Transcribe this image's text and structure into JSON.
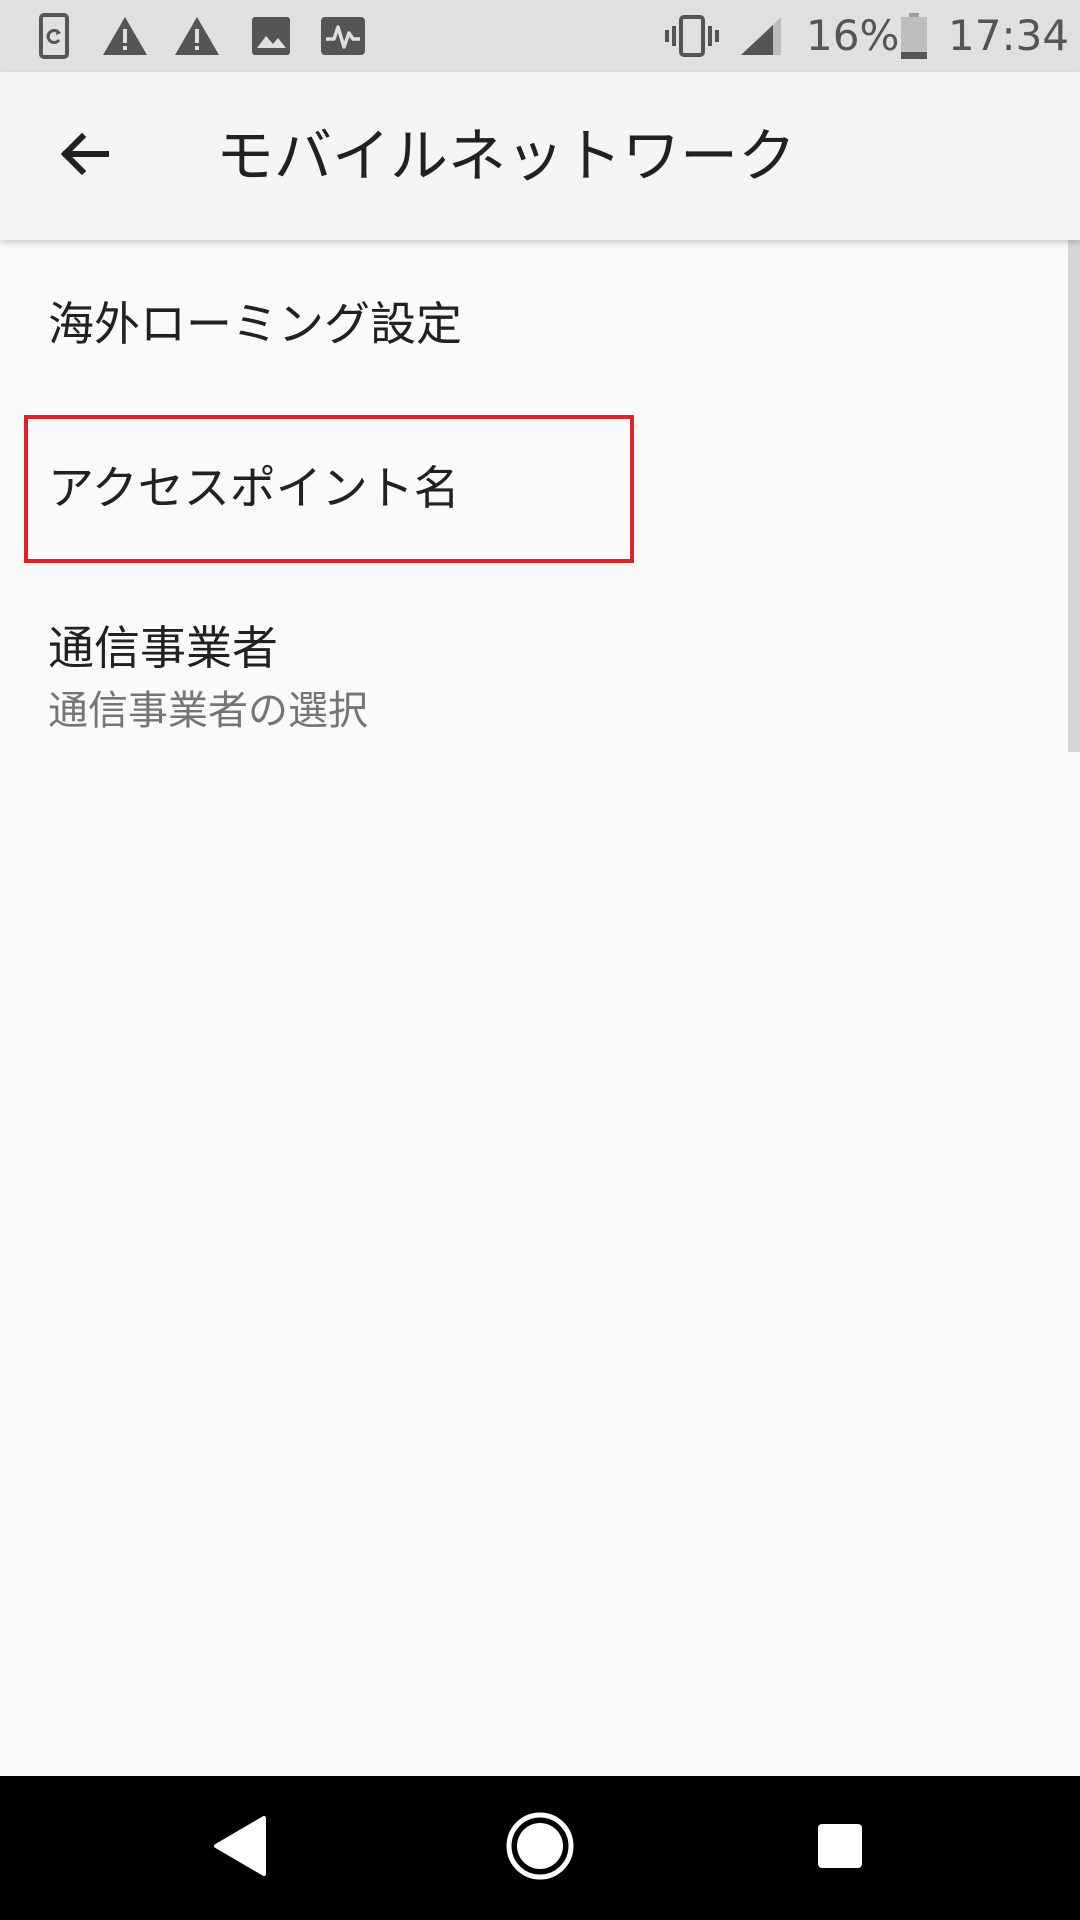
{
  "status_bar": {
    "icons": [
      "sync-phone-icon",
      "warning-icon",
      "warning-icon",
      "image-icon",
      "pulse-icon",
      "vibrate-icon",
      "signal-icon",
      "battery-icon"
    ],
    "battery_percent": "16%",
    "battery_level": 0.16,
    "time": "17:34"
  },
  "app_bar": {
    "back_icon": "arrow-back-icon",
    "title": "モバイルネットワーク"
  },
  "list": {
    "items": [
      {
        "title": "海外ローミング設定"
      },
      {
        "title": "アクセスポイント名"
      },
      {
        "title": "通信事業者",
        "summary": "通信事業者の選択"
      }
    ]
  },
  "nav_bar": {
    "icons": [
      "nav-back-icon",
      "home-icon",
      "recents-icon"
    ]
  },
  "colors": {
    "highlight": "#e0202a",
    "status_bar_bg": "#e0e0e0",
    "app_bar_bg": "#f5f5f5",
    "nav_bar_bg": "#000000"
  }
}
